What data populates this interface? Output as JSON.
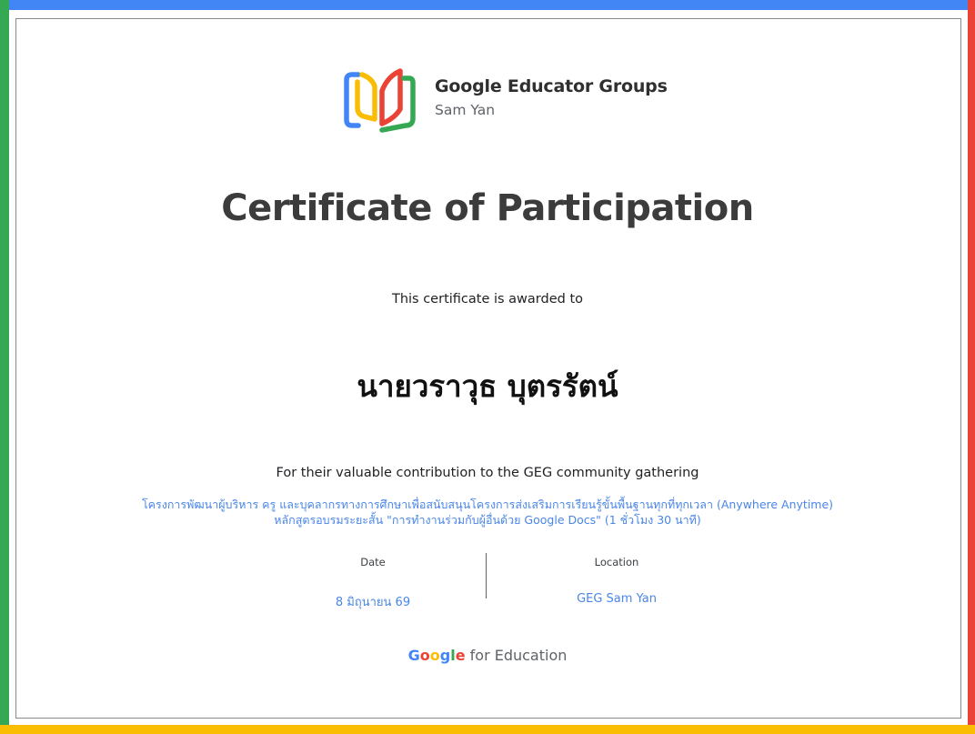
{
  "colors": {
    "google_blue": "#4285F4",
    "google_red": "#EA4335",
    "google_yellow": "#FBBC04",
    "google_green": "#34A853",
    "link_blue": "#4a86e8",
    "title_gray": "#3c3c3c",
    "frame_gray": "#8a8a8a"
  },
  "header": {
    "logo_icon": "open-book-icon",
    "brand_name": "Google Educator Groups",
    "chapter_name": "Sam Yan"
  },
  "certificate": {
    "title": "Certificate of Participation",
    "awarded_text": "This certificate is awarded to",
    "recipient_name": "นายวราวุธ บุตรรัตน์",
    "contribution_text": "For their valuable contribution to the GEG community gathering",
    "program_line_1": "โครงการพัฒนาผู้บริหาร ครู และบุคลากรทางการศึกษาเพื่อสนับสนุนโครงการส่งเสริมการเรียนรู้ขั้นพื้นฐานทุกที่ทุกเวลา (Anywhere Anytime)",
    "program_line_2": "หลักสูตรอบรมระยะสั้น \"การทำงานร่วมกับผู้อื่นด้วย Google Docs\" (1 ชั่วโมง 30 นาที)"
  },
  "details": {
    "date_label": "Date",
    "date_value": "8 มิถุนายน 69",
    "location_label": "Location",
    "location_value": "GEG Sam Yan"
  },
  "footer": {
    "google_letters": [
      "G",
      "o",
      "o",
      "g",
      "l",
      "e"
    ],
    "google_letter_colors": [
      "#4285F4",
      "#EA4335",
      "#FBBC04",
      "#4285F4",
      "#34A853",
      "#EA4335"
    ],
    "suffix": " for Education"
  }
}
